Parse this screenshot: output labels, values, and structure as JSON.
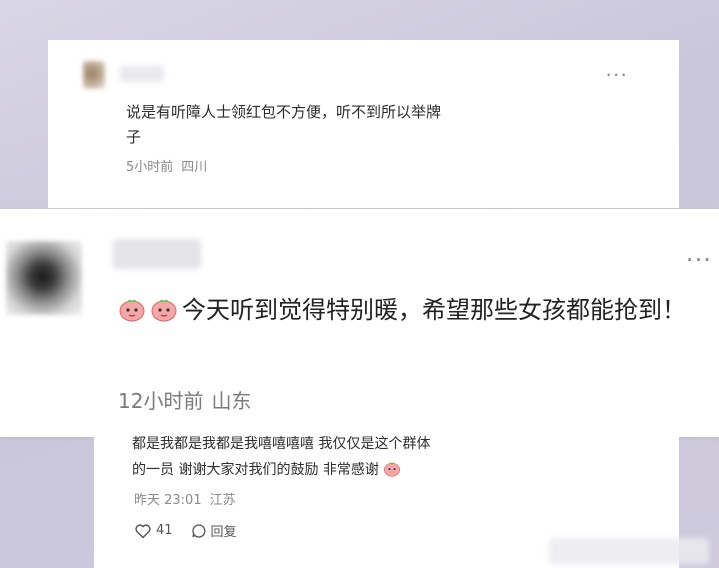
{
  "comments": [
    {
      "text": "说是有听障人士领红包不方便，听不到所以举牌子",
      "time": "5小时前",
      "location": "四川"
    },
    {
      "text": "今天听到觉得特别暖，希望那些女孩都能抢到！",
      "time": "12小时前",
      "location": "山东",
      "emoji_icons": [
        "peach-emoji-icon",
        "peach-emoji-icon"
      ]
    },
    {
      "text_partial_line": "都是我都是我都是我嘻嘻嘻嘻 我仅仅是这个群体",
      "text_line2": "的一员 谢谢大家对我们的鼓励 非常感谢",
      "time": "昨天 23:01",
      "location": "江苏",
      "likes": "41",
      "reply_label": "回复"
    }
  ],
  "colors": {
    "background": "#cfcbdd",
    "card": "#ffffff",
    "text": "#2d2d2d",
    "meta": "#8a8a8a"
  }
}
